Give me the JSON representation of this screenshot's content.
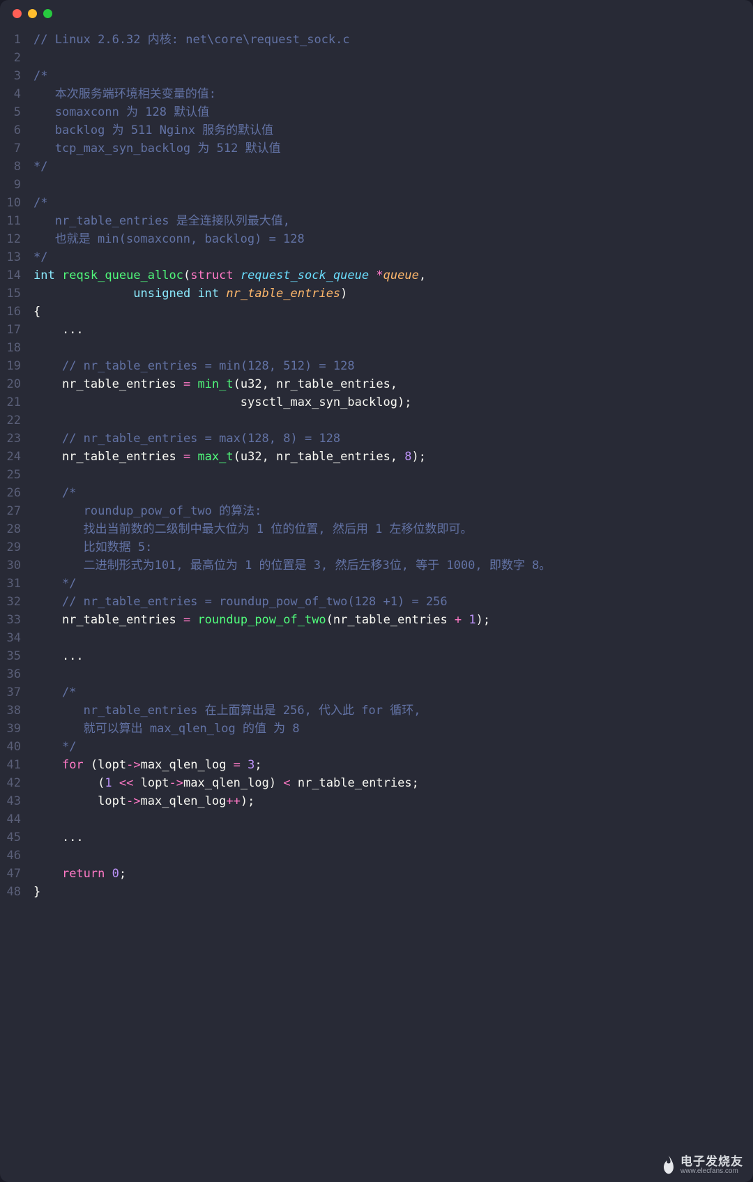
{
  "window": {
    "traffic_lights": [
      "red",
      "yellow",
      "green"
    ]
  },
  "watermark": {
    "name": "电子发烧友",
    "url": "www.elecfans.com"
  },
  "code_lines": [
    {
      "n": 1,
      "seg": [
        {
          "c": "cmt",
          "t": "// Linux 2.6.32 内核: net\\core\\request_sock.c"
        }
      ]
    },
    {
      "n": 2,
      "seg": []
    },
    {
      "n": 3,
      "seg": [
        {
          "c": "cmt",
          "t": "/*"
        }
      ]
    },
    {
      "n": 4,
      "seg": [
        {
          "c": "cmt",
          "t": "   本次服务端环境相关变量的值:"
        }
      ]
    },
    {
      "n": 5,
      "seg": [
        {
          "c": "cmt",
          "t": "   somaxconn 为 128 默认值"
        }
      ]
    },
    {
      "n": 6,
      "seg": [
        {
          "c": "cmt",
          "t": "   backlog 为 511 Nginx 服务的默认值"
        }
      ]
    },
    {
      "n": 7,
      "seg": [
        {
          "c": "cmt",
          "t": "   tcp_max_syn_backlog 为 512 默认值"
        }
      ]
    },
    {
      "n": 8,
      "seg": [
        {
          "c": "cmt",
          "t": "*/"
        }
      ]
    },
    {
      "n": 9,
      "seg": []
    },
    {
      "n": 10,
      "seg": [
        {
          "c": "cmt",
          "t": "/*"
        }
      ]
    },
    {
      "n": 11,
      "seg": [
        {
          "c": "cmt",
          "t": "   nr_table_entries 是全连接队列最大值,"
        }
      ]
    },
    {
      "n": 12,
      "seg": [
        {
          "c": "cmt",
          "t": "   也就是 min(somaxconn, backlog) = 128"
        }
      ]
    },
    {
      "n": 13,
      "seg": [
        {
          "c": "cmt",
          "t": "*/"
        }
      ]
    },
    {
      "n": 14,
      "seg": [
        {
          "c": "type",
          "t": "int"
        },
        {
          "c": "ident",
          "t": " "
        },
        {
          "c": "func",
          "t": "reqsk_queue_alloc"
        },
        {
          "c": "punc",
          "t": "("
        },
        {
          "c": "kw",
          "t": "struct"
        },
        {
          "c": "ident",
          "t": " "
        },
        {
          "c": "type2",
          "t": "request_sock_queue"
        },
        {
          "c": "ident",
          "t": " "
        },
        {
          "c": "op",
          "t": "*"
        },
        {
          "c": "param",
          "t": "queue"
        },
        {
          "c": "punc",
          "t": ","
        }
      ]
    },
    {
      "n": 15,
      "seg": [
        {
          "c": "ident",
          "t": "              "
        },
        {
          "c": "type",
          "t": "unsigned"
        },
        {
          "c": "ident",
          "t": " "
        },
        {
          "c": "type",
          "t": "int"
        },
        {
          "c": "ident",
          "t": " "
        },
        {
          "c": "param",
          "t": "nr_table_entries"
        },
        {
          "c": "punc",
          "t": ")"
        }
      ]
    },
    {
      "n": 16,
      "seg": [
        {
          "c": "punc",
          "t": "{"
        }
      ]
    },
    {
      "n": 17,
      "seg": [
        {
          "c": "ident",
          "t": "    ..."
        }
      ]
    },
    {
      "n": 18,
      "seg": []
    },
    {
      "n": 19,
      "seg": [
        {
          "c": "ident",
          "t": "    "
        },
        {
          "c": "cmt",
          "t": "// nr_table_entries = min(128, 512) = 128"
        }
      ]
    },
    {
      "n": 20,
      "seg": [
        {
          "c": "ident",
          "t": "    nr_table_entries "
        },
        {
          "c": "op",
          "t": "="
        },
        {
          "c": "ident",
          "t": " "
        },
        {
          "c": "func",
          "t": "min_t"
        },
        {
          "c": "punc",
          "t": "("
        },
        {
          "c": "ident",
          "t": "u32, nr_table_entries,"
        }
      ]
    },
    {
      "n": 21,
      "seg": [
        {
          "c": "ident",
          "t": "                             sysctl_max_syn_backlog"
        },
        {
          "c": "punc",
          "t": ");"
        }
      ]
    },
    {
      "n": 22,
      "seg": []
    },
    {
      "n": 23,
      "seg": [
        {
          "c": "ident",
          "t": "    "
        },
        {
          "c": "cmt",
          "t": "// nr_table_entries = max(128, 8) = 128"
        }
      ]
    },
    {
      "n": 24,
      "seg": [
        {
          "c": "ident",
          "t": "    nr_table_entries "
        },
        {
          "c": "op",
          "t": "="
        },
        {
          "c": "ident",
          "t": " "
        },
        {
          "c": "func",
          "t": "max_t"
        },
        {
          "c": "punc",
          "t": "("
        },
        {
          "c": "ident",
          "t": "u32, nr_table_entries, "
        },
        {
          "c": "num",
          "t": "8"
        },
        {
          "c": "punc",
          "t": ");"
        }
      ]
    },
    {
      "n": 25,
      "seg": []
    },
    {
      "n": 26,
      "seg": [
        {
          "c": "ident",
          "t": "    "
        },
        {
          "c": "cmt",
          "t": "/*"
        }
      ]
    },
    {
      "n": 27,
      "seg": [
        {
          "c": "ident",
          "t": "    "
        },
        {
          "c": "cmt",
          "t": "   roundup_pow_of_two 的算法:"
        }
      ]
    },
    {
      "n": 28,
      "seg": [
        {
          "c": "ident",
          "t": "    "
        },
        {
          "c": "cmt",
          "t": "   找出当前数的二级制中最大位为 1 位的位置, 然后用 1 左移位数即可。"
        }
      ]
    },
    {
      "n": 29,
      "seg": [
        {
          "c": "ident",
          "t": "    "
        },
        {
          "c": "cmt",
          "t": "   比如数据 5:"
        }
      ]
    },
    {
      "n": 30,
      "seg": [
        {
          "c": "ident",
          "t": "    "
        },
        {
          "c": "cmt",
          "t": "   二进制形式为101, 最高位为 1 的位置是 3, 然后左移3位, 等于 1000, 即数字 8。"
        }
      ]
    },
    {
      "n": 31,
      "seg": [
        {
          "c": "ident",
          "t": "    "
        },
        {
          "c": "cmt",
          "t": "*/"
        }
      ]
    },
    {
      "n": 32,
      "seg": [
        {
          "c": "ident",
          "t": "    "
        },
        {
          "c": "cmt",
          "t": "// nr_table_entries = roundup_pow_of_two(128 +1) = 256"
        }
      ]
    },
    {
      "n": 33,
      "seg": [
        {
          "c": "ident",
          "t": "    nr_table_entries "
        },
        {
          "c": "op",
          "t": "="
        },
        {
          "c": "ident",
          "t": " "
        },
        {
          "c": "func",
          "t": "roundup_pow_of_two"
        },
        {
          "c": "punc",
          "t": "("
        },
        {
          "c": "ident",
          "t": "nr_table_entries "
        },
        {
          "c": "op",
          "t": "+"
        },
        {
          "c": "ident",
          "t": " "
        },
        {
          "c": "num",
          "t": "1"
        },
        {
          "c": "punc",
          "t": ");"
        }
      ]
    },
    {
      "n": 34,
      "seg": []
    },
    {
      "n": 35,
      "seg": [
        {
          "c": "ident",
          "t": "    ..."
        }
      ]
    },
    {
      "n": 36,
      "seg": []
    },
    {
      "n": 37,
      "seg": [
        {
          "c": "ident",
          "t": "    "
        },
        {
          "c": "cmt",
          "t": "/*"
        }
      ]
    },
    {
      "n": 38,
      "seg": [
        {
          "c": "ident",
          "t": "    "
        },
        {
          "c": "cmt",
          "t": "   nr_table_entries 在上面算出是 256, 代入此 for 循环,"
        }
      ]
    },
    {
      "n": 39,
      "seg": [
        {
          "c": "ident",
          "t": "    "
        },
        {
          "c": "cmt",
          "t": "   就可以算出 max_qlen_log 的值 为 8"
        }
      ]
    },
    {
      "n": 40,
      "seg": [
        {
          "c": "ident",
          "t": "    "
        },
        {
          "c": "cmt",
          "t": "*/"
        }
      ]
    },
    {
      "n": 41,
      "seg": [
        {
          "c": "ident",
          "t": "    "
        },
        {
          "c": "kw",
          "t": "for"
        },
        {
          "c": "ident",
          "t": " "
        },
        {
          "c": "punc",
          "t": "("
        },
        {
          "c": "ident",
          "t": "lopt"
        },
        {
          "c": "op",
          "t": "->"
        },
        {
          "c": "ident",
          "t": "max_qlen_log "
        },
        {
          "c": "op",
          "t": "="
        },
        {
          "c": "ident",
          "t": " "
        },
        {
          "c": "num",
          "t": "3"
        },
        {
          "c": "punc",
          "t": ";"
        }
      ]
    },
    {
      "n": 42,
      "seg": [
        {
          "c": "ident",
          "t": "         "
        },
        {
          "c": "punc",
          "t": "("
        },
        {
          "c": "num",
          "t": "1"
        },
        {
          "c": "ident",
          "t": " "
        },
        {
          "c": "op",
          "t": "<<"
        },
        {
          "c": "ident",
          "t": " lopt"
        },
        {
          "c": "op",
          "t": "->"
        },
        {
          "c": "ident",
          "t": "max_qlen_log"
        },
        {
          "c": "punc",
          "t": ")"
        },
        {
          "c": "ident",
          "t": " "
        },
        {
          "c": "op",
          "t": "<"
        },
        {
          "c": "ident",
          "t": " nr_table_entries"
        },
        {
          "c": "punc",
          "t": ";"
        }
      ]
    },
    {
      "n": 43,
      "seg": [
        {
          "c": "ident",
          "t": "         lopt"
        },
        {
          "c": "op",
          "t": "->"
        },
        {
          "c": "ident",
          "t": "max_qlen_log"
        },
        {
          "c": "op",
          "t": "++"
        },
        {
          "c": "punc",
          "t": ");"
        }
      ]
    },
    {
      "n": 44,
      "seg": []
    },
    {
      "n": 45,
      "seg": [
        {
          "c": "ident",
          "t": "    ..."
        }
      ]
    },
    {
      "n": 46,
      "seg": []
    },
    {
      "n": 47,
      "seg": [
        {
          "c": "ident",
          "t": "    "
        },
        {
          "c": "kw",
          "t": "return"
        },
        {
          "c": "ident",
          "t": " "
        },
        {
          "c": "num",
          "t": "0"
        },
        {
          "c": "punc",
          "t": ";"
        }
      ]
    },
    {
      "n": 48,
      "seg": [
        {
          "c": "punc",
          "t": "}"
        }
      ]
    }
  ]
}
